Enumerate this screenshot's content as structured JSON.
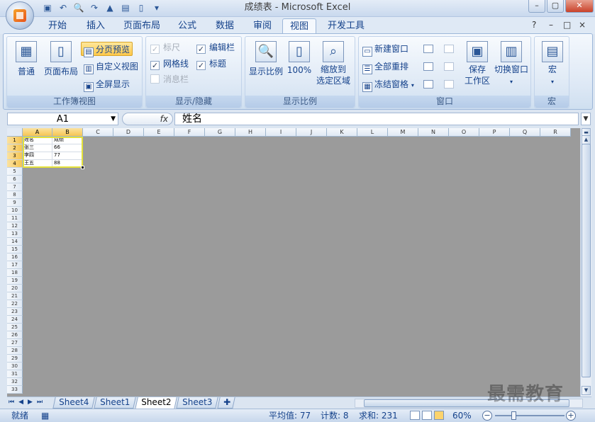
{
  "window": {
    "title": "成绩表 - Microsoft Excel",
    "controls": [
      "–",
      "▢",
      "✕"
    ]
  },
  "ribbon_tabs": [
    {
      "label": "开始"
    },
    {
      "label": "插入"
    },
    {
      "label": "页面布局"
    },
    {
      "label": "公式"
    },
    {
      "label": "数据"
    },
    {
      "label": "审阅"
    },
    {
      "label": "视图",
      "active": true
    },
    {
      "label": "开发工具"
    }
  ],
  "ribbon_right_controls": [
    "?",
    "–",
    "□",
    "×"
  ],
  "groups": {
    "workbook_views": {
      "label": "工作簿视图",
      "normal": "普通",
      "page_layout": "页面布局",
      "page_break_preview": "分页预览",
      "custom_views": "自定义视图",
      "full_screen": "全屏显示"
    },
    "show_hide": {
      "label": "显示/隐藏",
      "ruler": "标尺",
      "gridlines": "网格线",
      "message_bar": "消息栏",
      "formula_bar": "编辑栏",
      "headings": "标题"
    },
    "zoom": {
      "label": "显示比例",
      "zoom": "显示比例",
      "hundred": "100%",
      "zoom_selection_1": "缩放到",
      "zoom_selection_2": "选定区域"
    },
    "window": {
      "label": "窗口",
      "new_window": "新建窗口",
      "arrange_all": "全部重排",
      "freeze_panes": "冻结窗格",
      "save_workspace_1": "保存",
      "save_workspace_2": "工作区",
      "switch_windows": "切换窗口"
    },
    "macros": {
      "label": "宏",
      "macro": "宏"
    }
  },
  "formula_bar": {
    "name_box": "A1",
    "fx": "fx",
    "content": "姓名"
  },
  "sheet": {
    "columns": [
      "A",
      "B",
      "C",
      "D",
      "E",
      "F",
      "G",
      "H",
      "I",
      "J",
      "K",
      "L",
      "M",
      "N",
      "O",
      "P",
      "Q",
      "R"
    ],
    "rows": [
      "1",
      "2",
      "3",
      "4",
      "5",
      "6",
      "7",
      "8",
      "9",
      "10",
      "11",
      "12",
      "13",
      "14",
      "15",
      "16",
      "17",
      "18",
      "19",
      "20",
      "21",
      "22",
      "23",
      "24",
      "25",
      "26",
      "27",
      "28",
      "29",
      "30",
      "31",
      "32",
      "33"
    ],
    "cells": [
      [
        "姓名",
        "成绩"
      ],
      [
        "张三",
        "66"
      ],
      [
        "李四",
        "77"
      ],
      [
        "王五",
        "88"
      ]
    ]
  },
  "sheet_tabs": [
    {
      "label": "Sheet4"
    },
    {
      "label": "Sheet1"
    },
    {
      "label": "Sheet2",
      "active": true
    },
    {
      "label": "Sheet3"
    }
  ],
  "status": {
    "ready": "就绪",
    "average": "平均值: 77",
    "count": "计数: 8",
    "sum": "求和: 231",
    "zoom": "60%",
    "zoom_level_percent": 60
  },
  "watermark": "最需教育",
  "colors": {
    "selection_border": "#e5e23a",
    "highlight_button": "#ffc84a",
    "sheet_background": "#9b9b9b"
  }
}
